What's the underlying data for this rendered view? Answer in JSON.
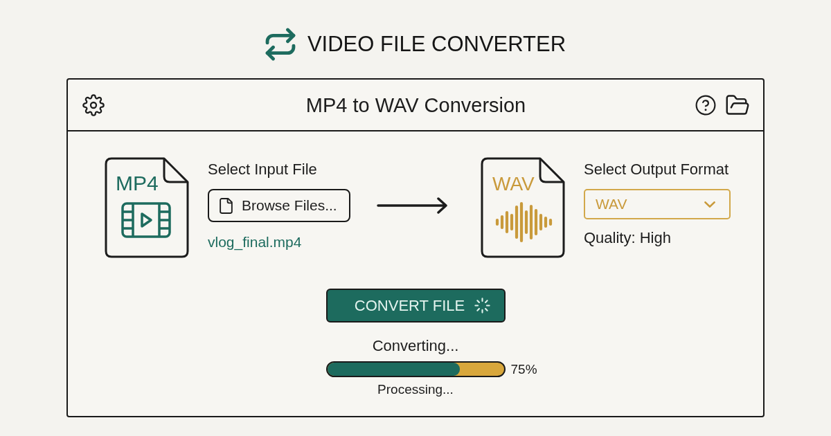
{
  "app": {
    "title": "VIDEO FILE CONVERTER"
  },
  "window": {
    "title": "MP4 to WAV Conversion"
  },
  "input": {
    "file_type": "MP4",
    "label": "Select Input File",
    "button": "Browse Files...",
    "file_name": "vlog_final.mp4"
  },
  "output": {
    "file_type": "WAV",
    "label": "Select Output Format",
    "format": "WAV",
    "quality": "Quality: High"
  },
  "convert_button": {
    "label": "CONVERT FILE",
    "busy": true
  },
  "progress": {
    "status": "Converting...",
    "level": 0.75,
    "reading": "75%",
    "detail": "Processing..."
  }
}
